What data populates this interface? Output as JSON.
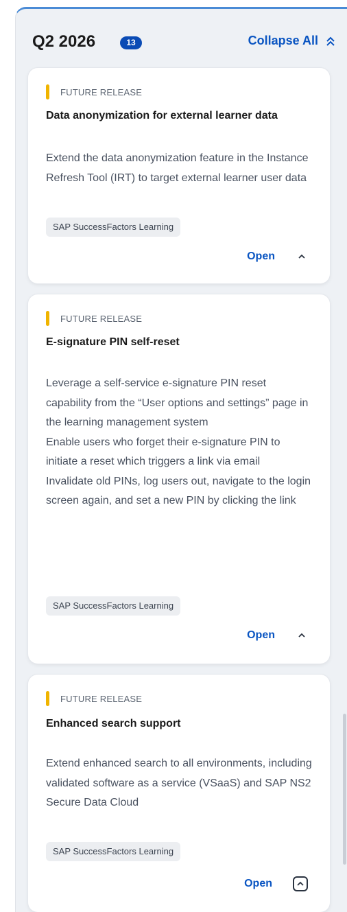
{
  "header": {
    "quarter": "Q2 2026",
    "count": "13",
    "collapse_all_label": "Collapse All"
  },
  "cards": [
    {
      "tag": "FUTURE RELEASE",
      "title": "Data anonymization for external learner data",
      "description": "Extend the data anonymization feature in the Instance Refresh Tool (IRT) to target external learner user data",
      "product": "SAP SuccessFactors Learning",
      "open_label": "Open"
    },
    {
      "tag": "FUTURE RELEASE",
      "title": "E-signature PIN self-reset",
      "description_lines": [
        "Leverage a self-service e-signature PIN reset capability from the “User options and settings” page in the learning management system",
        "Enable users who forget their e-signature PIN to initiate a reset which triggers a link via email",
        "Invalidate old PINs, log users out, navigate to the login screen again, and set a new PIN by clicking the link"
      ],
      "product": "SAP SuccessFactors Learning",
      "open_label": "Open"
    },
    {
      "tag": "FUTURE RELEASE",
      "title": "Enhanced search support",
      "description": "Extend enhanced search to all environments, including validated software as a service (VSaaS) and SAP NS2 Secure Data Cloud",
      "product": "SAP SuccessFactors Learning",
      "open_label": "Open"
    }
  ],
  "colors": {
    "accent": "#0a55c2",
    "badge": "#0a4bb5",
    "tag_bar": "#f0b400",
    "column_bg": "#eef1f5",
    "top_border": "#4a8bd6"
  },
  "icons": {
    "collapse_all": "double-chevron-up-icon",
    "card_collapse": "chevron-up-icon"
  }
}
